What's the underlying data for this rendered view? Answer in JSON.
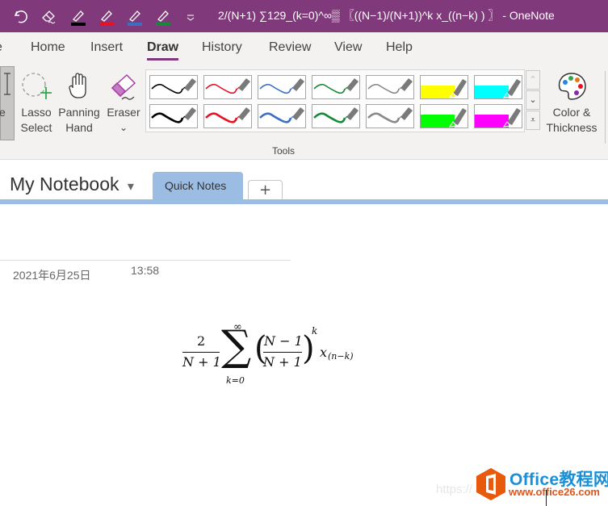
{
  "window": {
    "title": "2/(N+1) ∑129_(k=0)^∞▒ 〖((N−1)/(N+1))^k x_((n−k) ) 〗  -  OneNote"
  },
  "quick_access": {
    "items": [
      {
        "name": "undo",
        "icon": "undo-icon"
      },
      {
        "name": "eraser",
        "icon": "eraser-icon"
      },
      {
        "name": "pen-black",
        "icon": "pen-icon",
        "color": "#000000"
      },
      {
        "name": "pen-red",
        "icon": "pen-icon",
        "color": "#e81123"
      },
      {
        "name": "pen-blue",
        "icon": "pen-icon",
        "color": "#3a6fc4"
      },
      {
        "name": "pen-green",
        "icon": "pen-icon",
        "color": "#138a36"
      },
      {
        "name": "customize",
        "icon": "customize-qat-icon"
      }
    ]
  },
  "ribbon_tabs": [
    {
      "label": "Home",
      "active": false
    },
    {
      "label": "Insert",
      "active": false
    },
    {
      "label": "Draw",
      "active": true
    },
    {
      "label": "History",
      "active": false
    },
    {
      "label": "Review",
      "active": false
    },
    {
      "label": "View",
      "active": false
    },
    {
      "label": "Help",
      "active": false
    }
  ],
  "ribbon": {
    "partial_tab_left": "e",
    "tools": [
      {
        "line1": "Lasso",
        "line2": "Select"
      },
      {
        "line1": "Panning",
        "line2": "Hand"
      },
      {
        "line1": "Eraser",
        "line2": "⌄"
      }
    ],
    "pens": [
      {
        "type": "pen",
        "color": "#000000",
        "row": 1
      },
      {
        "type": "pen",
        "color": "#e81123",
        "row": 1
      },
      {
        "type": "pen",
        "color": "#3a6fc4",
        "row": 1
      },
      {
        "type": "pen",
        "color": "#138a36",
        "row": 1
      },
      {
        "type": "pen",
        "color": "#888888",
        "row": 1
      },
      {
        "type": "highlighter",
        "color": "#ffff00",
        "row": 1
      },
      {
        "type": "highlighter",
        "color": "#00ffff",
        "row": 1
      },
      {
        "type": "pen",
        "color": "#000000",
        "row": 2
      },
      {
        "type": "pen",
        "color": "#e81123",
        "row": 2
      },
      {
        "type": "pen",
        "color": "#3a6fc4",
        "row": 2
      },
      {
        "type": "pen",
        "color": "#138a36",
        "row": 2
      },
      {
        "type": "pen",
        "color": "#888888",
        "row": 2
      },
      {
        "type": "highlighter",
        "color": "#00ff00",
        "row": 2
      },
      {
        "type": "highlighter",
        "color": "#ff00ff",
        "row": 2
      }
    ],
    "gallery_scroll": {
      "up": "⌃",
      "down": "⌄",
      "more": "⩡"
    },
    "color_thickness": {
      "line1": "Color &",
      "line2": "Thickness"
    },
    "group_label": "Tools"
  },
  "notebook": {
    "name": "My Notebook",
    "dropdown": "▾",
    "section_tab": "Quick Notes",
    "add_tab": "+"
  },
  "page": {
    "date": "2021年6月25日",
    "time": "13:58",
    "equation": {
      "frac1_num": "2",
      "frac1_den": "N + 1",
      "sum": "∑",
      "sum_upper": "∞",
      "sum_lower": "k=0",
      "lparen": "(",
      "frac2_num": "N − 1",
      "frac2_den": "N + 1",
      "rparen": ")",
      "exponent": "k",
      "var": "x",
      "subscript": "(n−k)"
    }
  },
  "watermark": {
    "url_faded": "https://",
    "brand": "Office教程网",
    "site": "www.office26.com"
  }
}
